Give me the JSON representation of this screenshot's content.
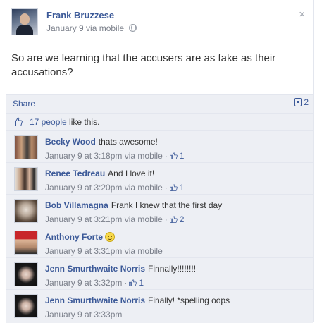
{
  "post": {
    "author": "Frank Bruzzese",
    "meta": "January 9 via mobile",
    "message": "So are we learning that the accusers are as fake as their accusations?",
    "close_glyph": "×"
  },
  "actions": {
    "share_label": "Share",
    "shares_count": "2"
  },
  "likes": {
    "people_link": "17 people",
    "suffix": " like this."
  },
  "comments": [
    {
      "name": "Becky Wood",
      "text": "thats awesome!",
      "time": "January 9 at 3:18pm via mobile",
      "likes": "1"
    },
    {
      "name": "Renee Tedreau",
      "text": "And I love it!",
      "time": "January 9 at 3:20pm via mobile",
      "likes": "1"
    },
    {
      "name": "Bob Villamagna",
      "text": "Frank I knew that the first day",
      "time": "January 9 at 3:21pm via mobile",
      "likes": "2"
    },
    {
      "name": "Anthony Forte",
      "text": "",
      "time": "January 9 at 3:31pm via mobile",
      "likes": ""
    },
    {
      "name": "Jenn Smurthwaite Norris",
      "text": "Finnally!!!!!!!!",
      "time": "January 9 at 3:32pm",
      "likes": "1"
    },
    {
      "name": "Jenn Smurthwaite Norris",
      "text": "Finally! *spelling oops",
      "time": "January 9 at 3:33pm",
      "likes": ""
    }
  ],
  "colors": {
    "link": "#3b5998",
    "panel": "#edeff4",
    "meta": "#7a7f8a"
  }
}
